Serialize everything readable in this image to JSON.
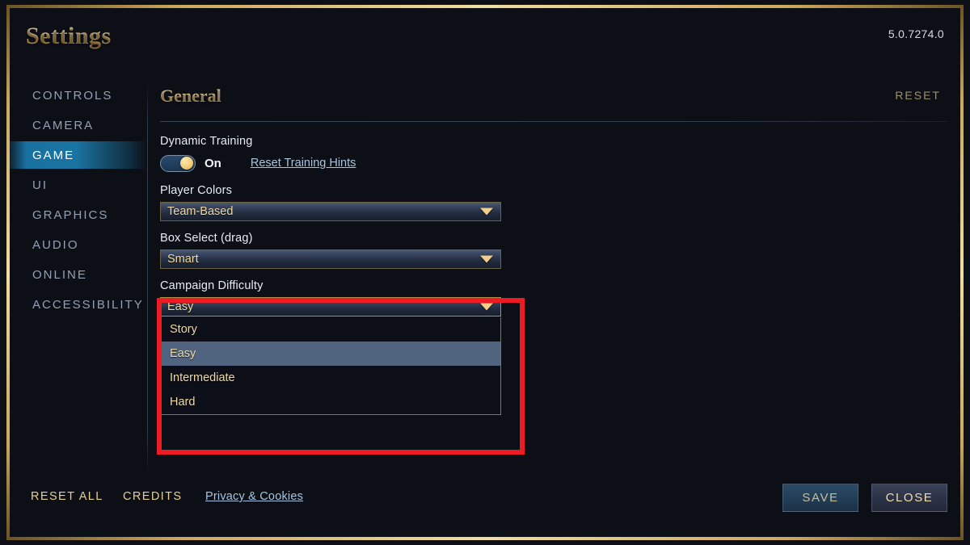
{
  "window": {
    "title": "Settings",
    "version": "5.0.7274.0"
  },
  "sidebar": {
    "items": [
      {
        "label": "CONTROLS",
        "active": false
      },
      {
        "label": "CAMERA",
        "active": false
      },
      {
        "label": "GAME",
        "active": true
      },
      {
        "label": "UI",
        "active": false
      },
      {
        "label": "GRAPHICS",
        "active": false
      },
      {
        "label": "AUDIO",
        "active": false
      },
      {
        "label": "ONLINE",
        "active": false
      },
      {
        "label": "ACCESSIBILITY",
        "active": false
      }
    ]
  },
  "content": {
    "section_title": "General",
    "reset_label": "RESET",
    "dynamic_training": {
      "label": "Dynamic Training",
      "state": "On",
      "link_label": "Reset Training Hints"
    },
    "player_colors": {
      "label": "Player Colors",
      "value": "Team-Based"
    },
    "box_select": {
      "label": "Box Select (drag)",
      "value": "Smart"
    },
    "campaign_difficulty": {
      "label": "Campaign Difficulty",
      "value": "Easy",
      "open": true,
      "options": [
        {
          "label": "Story",
          "selected": false
        },
        {
          "label": "Easy",
          "selected": true
        },
        {
          "label": "Intermediate",
          "selected": false
        },
        {
          "label": "Hard",
          "selected": false
        }
      ]
    }
  },
  "footer": {
    "reset_all": "RESET ALL",
    "credits": "CREDITS",
    "privacy": "Privacy & Cookies",
    "save": "SAVE",
    "close": "CLOSE"
  },
  "annotation": {
    "color": "#ed1c24",
    "target": "campaign-difficulty-dropdown"
  },
  "colors": {
    "panel_bg": "#222b3d",
    "accent_gold": "#f0d9a4",
    "accent_blue": "#1a74a2",
    "highlight_row": "#51647f",
    "link": "#a8c4e0"
  }
}
